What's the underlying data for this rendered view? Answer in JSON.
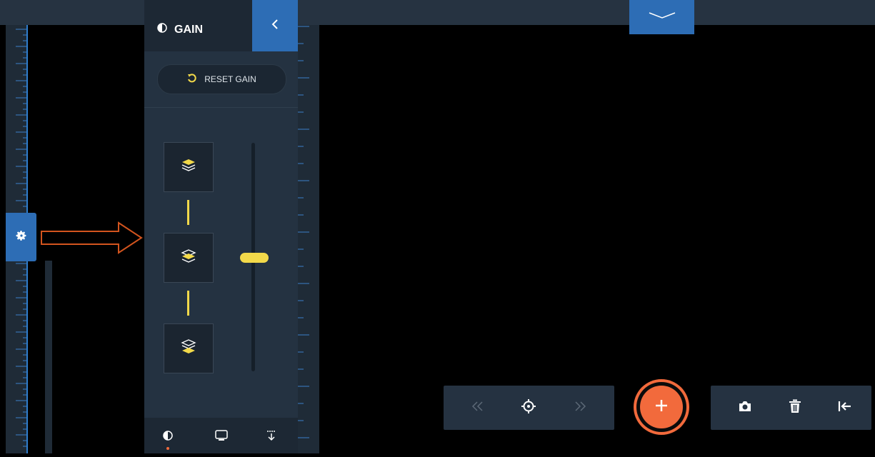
{
  "panel": {
    "title": "GAIN",
    "reset_label": "RESET GAIN",
    "levels": [
      "gain-high",
      "gain-mid",
      "gain-low"
    ],
    "slider_value": 0.5
  },
  "footer": {
    "tabs": [
      "contrast-icon",
      "monitor-icon",
      "download-icon"
    ],
    "active_tab": "contrast-icon"
  },
  "toolbar": {
    "nav": [
      "rewind-icon",
      "crosshair-icon",
      "forward-icon"
    ],
    "add": "plus-icon",
    "tools": [
      "camera-icon",
      "trash-icon",
      "collapse-left-icon"
    ]
  },
  "colors": {
    "accent_blue": "#2d6db5",
    "accent_yellow": "#f2d94a",
    "accent_orange": "#f26a3c",
    "panel_bg": "#243241"
  }
}
